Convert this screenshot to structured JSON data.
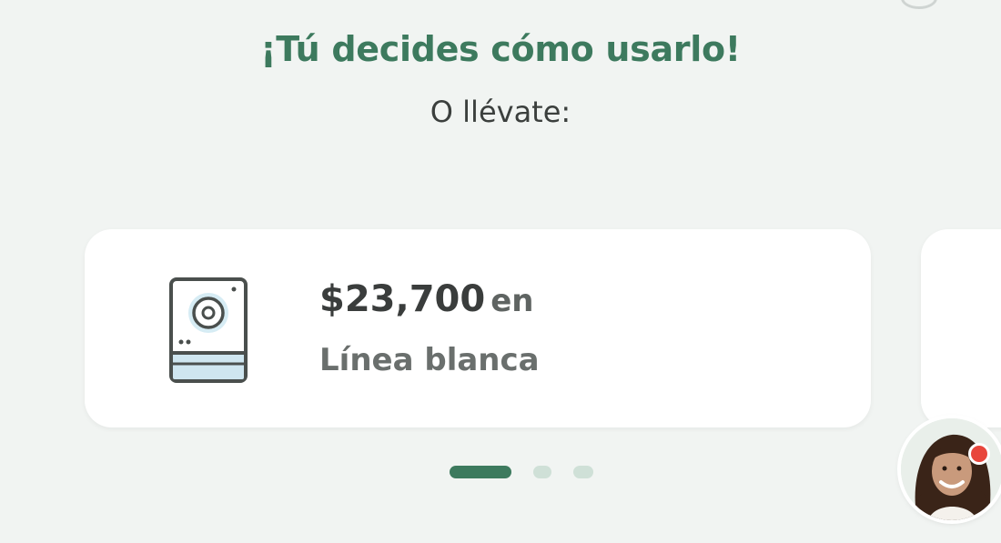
{
  "promo": {
    "headline": "¡Tú decides cómo usarlo!",
    "subhead": "O llévate:"
  },
  "carousel": {
    "cards": [
      {
        "amount": "$23,700",
        "connector": "en",
        "category": "Línea blanca",
        "icon": "washing-machine-icon"
      }
    ],
    "page_count": 3,
    "active_page": 1
  },
  "colors": {
    "accent": "#3d7a5e",
    "background": "#f1f4f2",
    "card": "#ffffff",
    "dot_inactive": "#cfe0d7",
    "record_indicator": "#e8463c"
  },
  "assistant": {
    "icon": "assistant-avatar-icon",
    "indicator": "recording-indicator-icon"
  }
}
